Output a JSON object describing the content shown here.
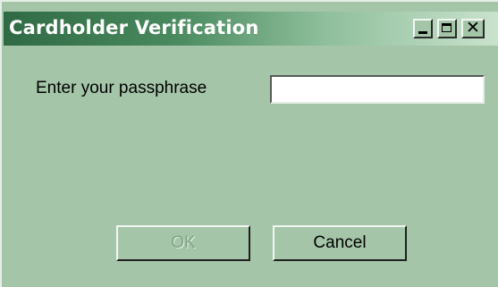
{
  "window": {
    "title": "Cardholder Verification"
  },
  "titlebar_buttons": {
    "minimize_icon": "minimize-icon",
    "maximize_icon": "maximize-icon",
    "close_glyph": "✕",
    "close_icon": "close-icon"
  },
  "form": {
    "prompt_label": "Enter your passphrase",
    "passphrase_value": ""
  },
  "buttons": {
    "ok_label": "OK",
    "ok_enabled": false,
    "cancel_label": "Cancel"
  },
  "colors": {
    "window_background": "#a4c5a8",
    "titlebar_start": "#2f6a44",
    "titlebar_end": "#c9e2cc",
    "disabled_text": "#7fa485"
  }
}
